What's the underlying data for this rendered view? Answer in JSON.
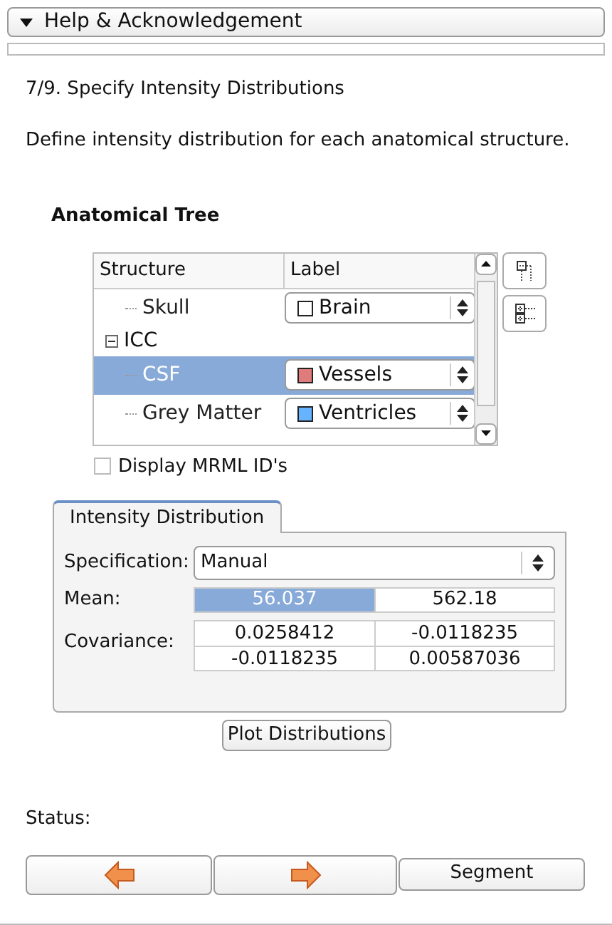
{
  "header": {
    "title": "Help & Acknowledgement",
    "expanded": true
  },
  "step": {
    "title": "7/9. Specify Intensity Distributions",
    "description": "Define intensity distribution for each anatomical structure."
  },
  "tree_title": "Anatomical Tree",
  "tree": {
    "columns": [
      "Structure",
      "Label"
    ],
    "items": [
      {
        "name": "Skull",
        "selected": false,
        "label": {
          "text": "Brain",
          "color": "#ffffff"
        }
      },
      {
        "name": "ICC",
        "selected": false,
        "expanded": true,
        "children": [
          {
            "name": "CSF",
            "selected": true,
            "label": {
              "text": "Vessels",
              "color": "#e07b7b"
            }
          },
          {
            "name": "Grey Matter",
            "selected": false,
            "label": {
              "text": "Ventricles",
              "color": "#66b3ff"
            }
          }
        ]
      }
    ]
  },
  "display_ids": {
    "label": "Display MRML ID's",
    "checked": false
  },
  "tab": {
    "label": "Intensity Distribution",
    "selected": true
  },
  "specification": {
    "label": "Specification:",
    "value": "Manual"
  },
  "mean": {
    "label": "Mean:",
    "values": [
      {
        "text": "56.037",
        "selected": true
      },
      {
        "text": "562.18",
        "selected": false
      }
    ]
  },
  "covariance": {
    "label": "Covariance:",
    "rows": [
      [
        "0.0258412",
        "-0.0118235"
      ],
      [
        "-0.0118235",
        "0.00587036"
      ]
    ]
  },
  "plot_button": "Plot Distributions",
  "status": {
    "label": "Status:"
  },
  "nav": {
    "finish": "Segment"
  }
}
